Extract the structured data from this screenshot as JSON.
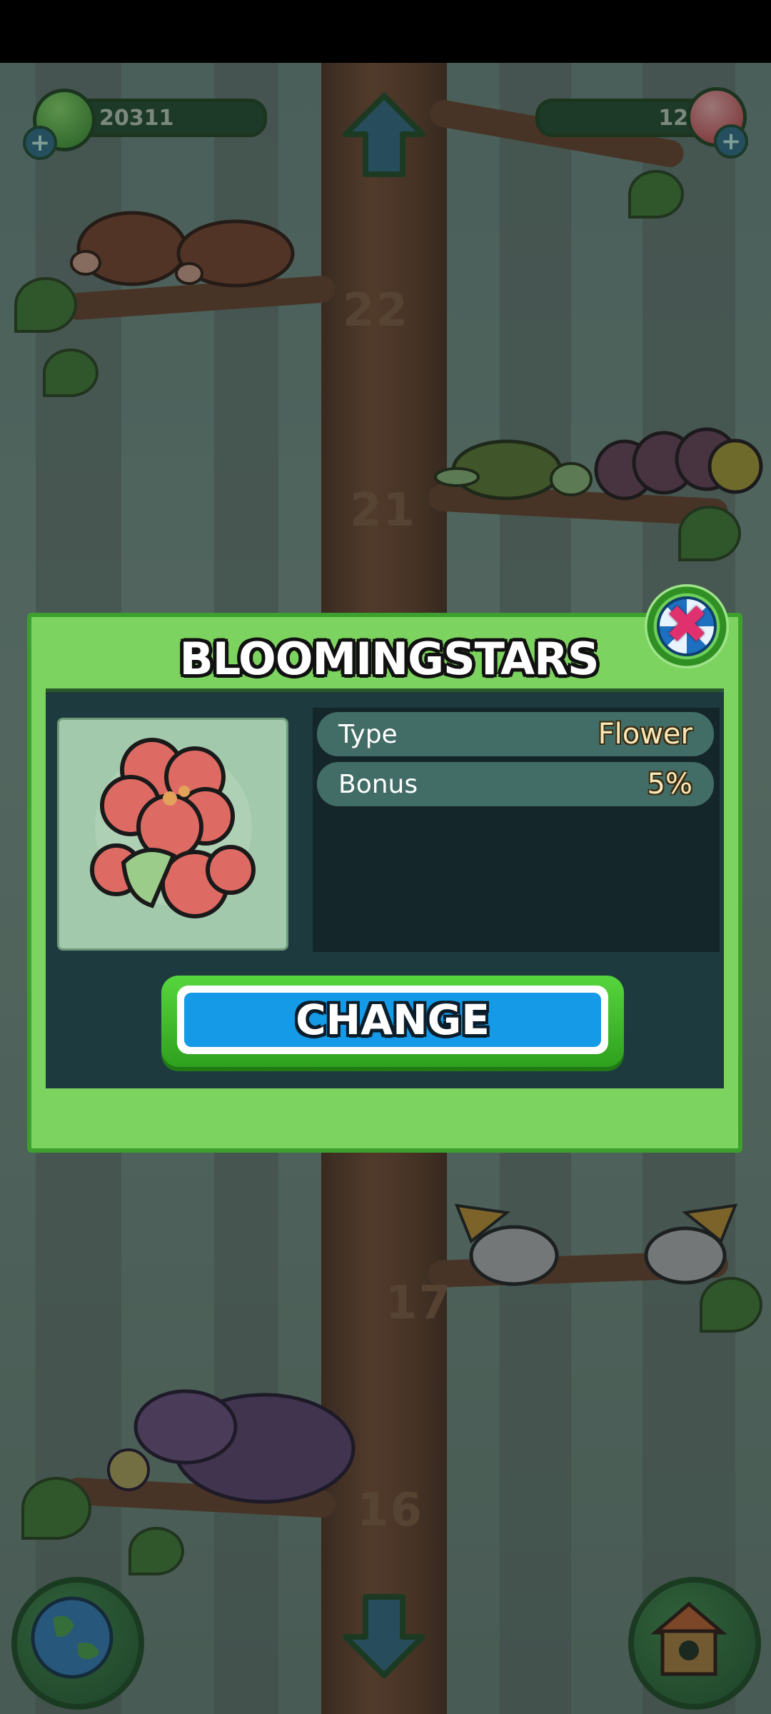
{
  "hud": {
    "gems": "20311",
    "crystals": "124",
    "plus_symbol": "+"
  },
  "tree": {
    "levels": [
      "22",
      "21",
      "17",
      "16"
    ]
  },
  "dialog": {
    "title": "BLOOMINGSTARS",
    "close_symbol": "✖",
    "info": [
      {
        "label": "Type",
        "value": "Flower"
      },
      {
        "label": "Bonus",
        "value": "5%"
      }
    ],
    "change_label": "CHANGE"
  },
  "colors": {
    "dialog_green": "#7dd35f",
    "panel_dark": "#1d3a3e",
    "button_blue": "#149ae6",
    "close_pink": "#e0306e"
  },
  "icons": {
    "world": "globe-icon",
    "home": "birdhouse-icon",
    "up": "up-arrow-icon",
    "down": "down-arrow-icon"
  }
}
